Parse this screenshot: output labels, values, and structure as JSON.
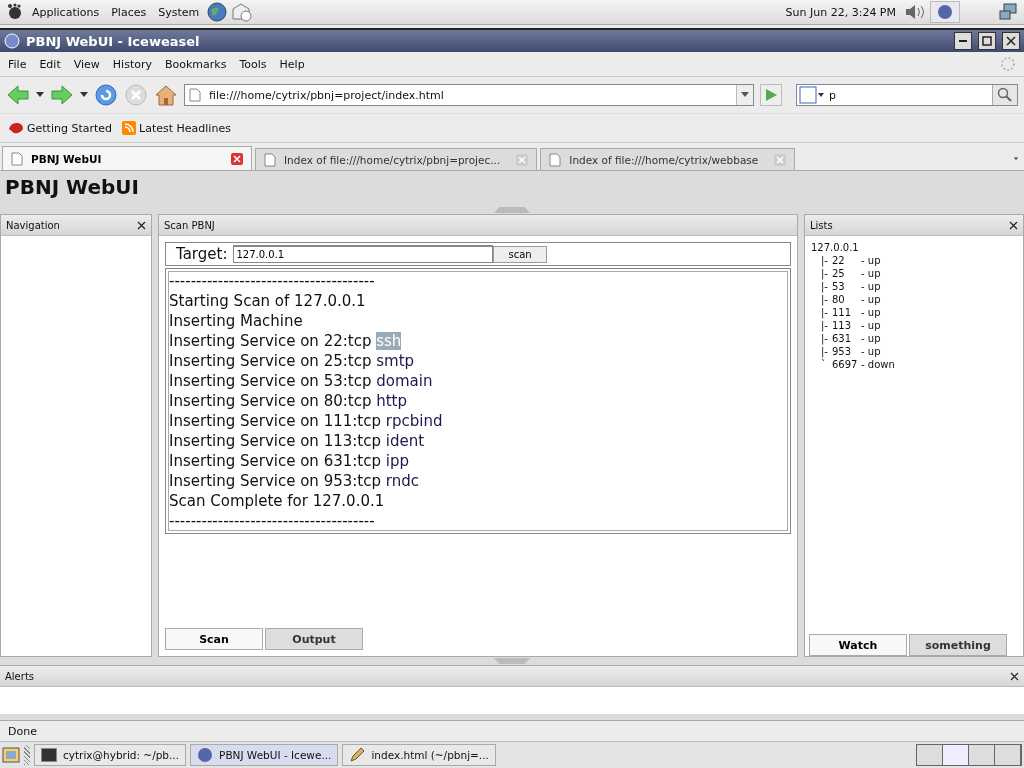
{
  "top_panel": {
    "menus": [
      "Applications",
      "Places",
      "System"
    ],
    "clock": "Sun Jun 22,  3:24 PM"
  },
  "window": {
    "title": "PBNJ WebUI - Iceweasel"
  },
  "menubar": [
    "File",
    "Edit",
    "View",
    "History",
    "Bookmarks",
    "Tools",
    "Help"
  ],
  "address": {
    "value": "file:///home/cytrix/pbnj=project/index.html"
  },
  "search": {
    "value": "p"
  },
  "bookmarks": [
    "Getting Started",
    "Latest Headlines"
  ],
  "tabs": [
    {
      "label": "PBNJ WebUI",
      "selected": true
    },
    {
      "label": "Index of file:///home/cytrix/pbnj=projec...",
      "selected": false
    },
    {
      "label": "Index of file:///home/cytrix/webbase",
      "selected": false
    }
  ],
  "page": {
    "heading": "PBNJ WebUI",
    "navigation": {
      "title": "Navigation"
    },
    "scan": {
      "title": "Scan PBNJ",
      "target_label": "Target:",
      "target_value": "127.0.0.1",
      "button": "scan",
      "log": [
        {
          "text": "--------------------------------------"
        },
        {
          "text": "Starting Scan of 127.0.0.1"
        },
        {
          "text": "Inserting Machine"
        },
        {
          "text": "Inserting Service on 22:tcp",
          "service": "ssh",
          "selected": true
        },
        {
          "text": "Inserting Service on 25:tcp",
          "service": "smtp",
          "selected": false
        },
        {
          "text": "Inserting Service on 53:tcp",
          "service": "domain",
          "selected": false
        },
        {
          "text": "Inserting Service on 80:tcp",
          "service": "http",
          "selected": false
        },
        {
          "text": "Inserting Service on 111:tcp",
          "service": "rpcbind",
          "selected": false
        },
        {
          "text": "Inserting Service on 113:tcp",
          "service": "ident",
          "selected": false
        },
        {
          "text": "Inserting Service on 631:tcp",
          "service": "ipp",
          "selected": false
        },
        {
          "text": "Inserting Service on 953:tcp",
          "service": "rndc",
          "selected": false
        },
        {
          "text": "Scan Complete for 127.0.0.1"
        },
        {
          "text": "--------------------------------------"
        }
      ],
      "tabs": [
        {
          "label": "Scan",
          "selected": true
        },
        {
          "label": "Output",
          "selected": false
        }
      ]
    },
    "lists": {
      "title": "Lists",
      "tree": [
        {
          "label": "127.0.0.1",
          "children": [
            {
              "branch": "|-",
              "port": "22",
              "status": "- up"
            },
            {
              "branch": "|-",
              "port": "25",
              "status": "- up"
            },
            {
              "branch": "|-",
              "port": "53",
              "status": "- up"
            },
            {
              "branch": "|-",
              "port": "80",
              "status": "- up"
            },
            {
              "branch": "|-",
              "port": "111",
              "status": "- up"
            },
            {
              "branch": "|-",
              "port": "113",
              "status": "- up"
            },
            {
              "branch": "|-",
              "port": "631",
              "status": "- up"
            },
            {
              "branch": "|-",
              "port": "953",
              "status": "- up"
            },
            {
              "branch": "`",
              "port": "6697",
              "status": "- down"
            }
          ]
        }
      ],
      "tabs": [
        {
          "label": "Watch",
          "selected": true
        },
        {
          "label": "something",
          "selected": false
        }
      ]
    },
    "alerts": {
      "title": "Alerts"
    }
  },
  "status_bar": {
    "text": "Done"
  },
  "taskbar": [
    {
      "label": "cytrix@hybrid: ~/pb...",
      "kind": "terminal",
      "selected": false
    },
    {
      "label": "PBNJ WebUI - Icewe...",
      "kind": "browser",
      "selected": true
    },
    {
      "label": "index.html (~/pbnj=...",
      "kind": "editor",
      "selected": false
    }
  ]
}
